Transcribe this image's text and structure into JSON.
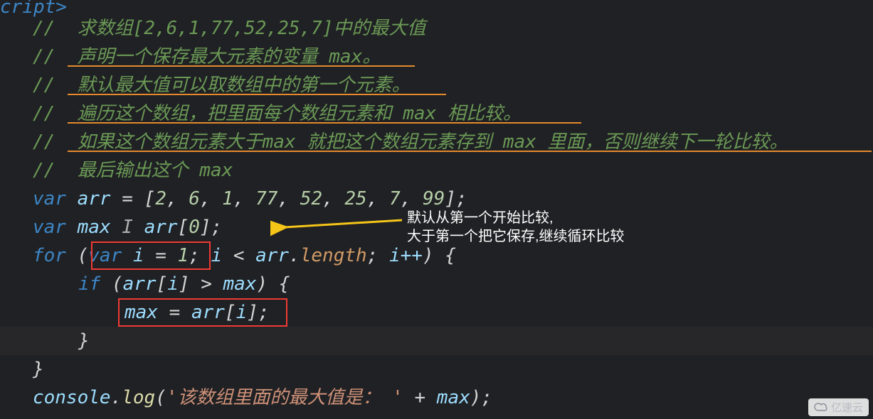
{
  "top_fragment": "cript>",
  "comments": {
    "c1": "//  求数组[2,6,1,77,52,25,7]中的最大值",
    "c2": "//  声明一个保存最大元素的变量 max。",
    "c3": "//  默认最大值可以取数组中的第一个元素。",
    "c4": "//  遍历这个数组，把里面每个数组元素和 max 相比较。",
    "c5": "//  如果这个数组元素大于max 就把这个数组元素存到 max 里面，否则继续下一轮比较。",
    "c6": "//  最后输出这个 max"
  },
  "code": {
    "arr_decl_kw": "var",
    "arr_name": "arr",
    "arr_vals": [
      "2",
      "6",
      "1",
      "77",
      "52",
      "25",
      "7",
      "99"
    ],
    "max_decl_kw": "var",
    "max_name": "max",
    "max_init_arr": "arr",
    "max_init_idx": "0",
    "for_kw": "for",
    "for_init_kw": "var",
    "for_i": "i",
    "for_init_val": "1",
    "for_cond_arr": "arr",
    "for_cond_len": "length",
    "for_inc": "i++",
    "if_kw": "if",
    "if_arr": "arr",
    "if_i": "i",
    "if_cmp": "max",
    "assign_max": "max",
    "assign_arr": "arr",
    "assign_i": "i",
    "log_obj": "console",
    "log_fn": "log",
    "log_str": "'该数组里面的最大值是： '",
    "log_plus": "max"
  },
  "annotation": {
    "l1": "默认从第一个开始比较,",
    "l2": "大于第一个把它保存,继续循环比较"
  },
  "watermark": "亿速云"
}
